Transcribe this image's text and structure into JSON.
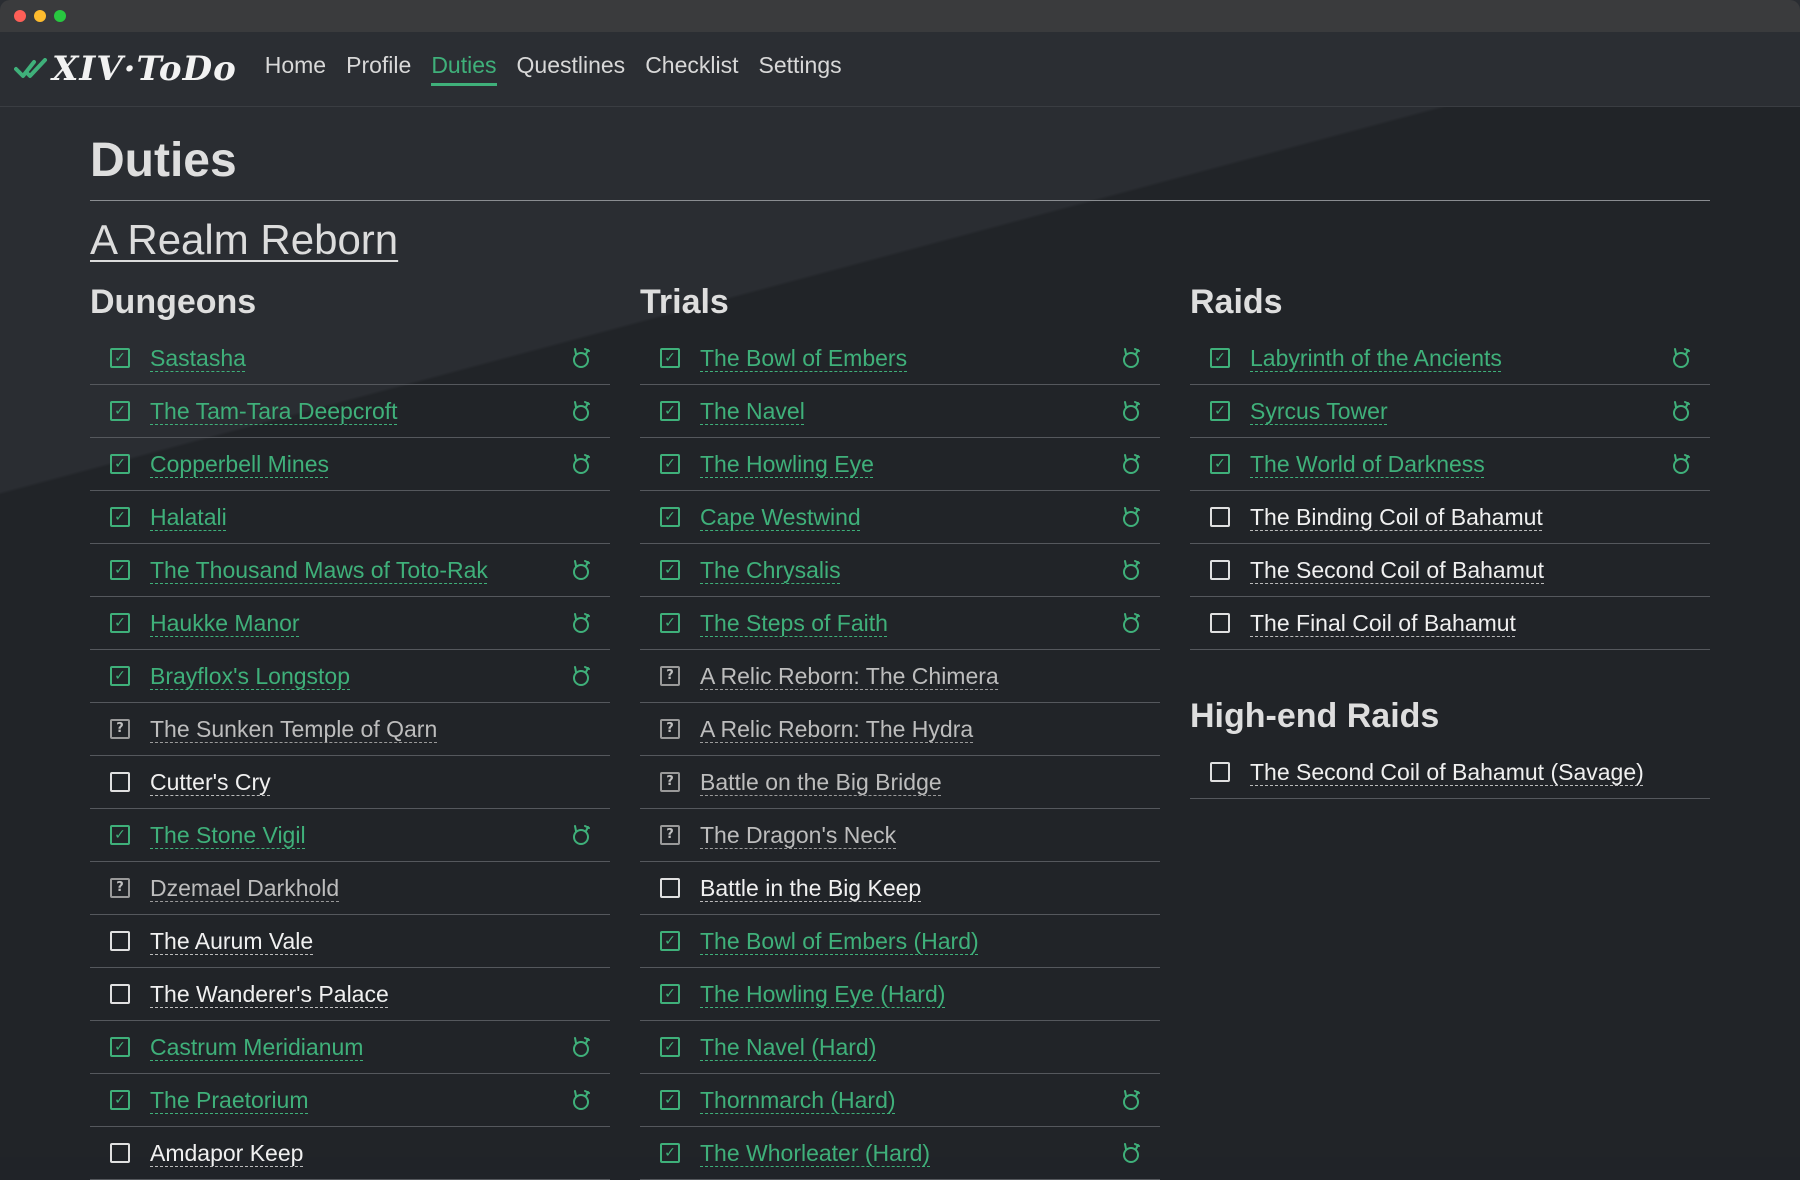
{
  "app": {
    "brand": "XIV·ToDo",
    "nav": [
      {
        "label": "Home",
        "active": false
      },
      {
        "label": "Profile",
        "active": false
      },
      {
        "label": "Duties",
        "active": true
      },
      {
        "label": "Questlines",
        "active": false
      },
      {
        "label": "Checklist",
        "active": false
      },
      {
        "label": "Settings",
        "active": false
      }
    ],
    "accent_color": "#3fb07a"
  },
  "page": {
    "title": "Duties",
    "expansion": "A Realm Reborn"
  },
  "dungeons": {
    "title": "Dungeons",
    "items": [
      {
        "name": "Sastasha",
        "status": "done",
        "icon": "moogle-icon"
      },
      {
        "name": "The Tam-Tara Deepcroft",
        "status": "done",
        "icon": "moogle-icon"
      },
      {
        "name": "Copperbell Mines",
        "status": "done",
        "icon": "moogle-icon"
      },
      {
        "name": "Halatali",
        "status": "done",
        "icon": ""
      },
      {
        "name": "The Thousand Maws of Toto-Rak",
        "status": "done",
        "icon": "moogle-icon"
      },
      {
        "name": "Haukke Manor",
        "status": "done",
        "icon": "moogle-icon"
      },
      {
        "name": "Brayflox's Longstop",
        "status": "done",
        "icon": "moogle-icon"
      },
      {
        "name": "The Sunken Temple of Qarn",
        "status": "unknown",
        "icon": ""
      },
      {
        "name": "Cutter's Cry",
        "status": "todo",
        "icon": ""
      },
      {
        "name": "The Stone Vigil",
        "status": "done",
        "icon": "moogle-icon"
      },
      {
        "name": "Dzemael Darkhold",
        "status": "unknown",
        "icon": ""
      },
      {
        "name": "The Aurum Vale",
        "status": "todo",
        "icon": ""
      },
      {
        "name": "The Wanderer's Palace",
        "status": "todo",
        "icon": ""
      },
      {
        "name": "Castrum Meridianum",
        "status": "done",
        "icon": "moogle-icon"
      },
      {
        "name": "The Praetorium",
        "status": "done",
        "icon": "moogle-icon"
      },
      {
        "name": "Amdapor Keep",
        "status": "todo",
        "icon": ""
      }
    ]
  },
  "trials": {
    "title": "Trials",
    "items": [
      {
        "name": "The Bowl of Embers",
        "status": "done",
        "icon": "moogle-icon"
      },
      {
        "name": "The Navel",
        "status": "done",
        "icon": "moogle-icon"
      },
      {
        "name": "The Howling Eye",
        "status": "done",
        "icon": "moogle-icon"
      },
      {
        "name": "Cape Westwind",
        "status": "done",
        "icon": "moogle-icon"
      },
      {
        "name": "The Chrysalis",
        "status": "done",
        "icon": "moogle-icon"
      },
      {
        "name": "The Steps of Faith",
        "status": "done",
        "icon": "moogle-icon"
      },
      {
        "name": "A Relic Reborn: The Chimera",
        "status": "unknown",
        "icon": ""
      },
      {
        "name": "A Relic Reborn: The Hydra",
        "status": "unknown",
        "icon": ""
      },
      {
        "name": "Battle on the Big Bridge",
        "status": "unknown",
        "icon": ""
      },
      {
        "name": "The Dragon's Neck",
        "status": "unknown",
        "icon": ""
      },
      {
        "name": "Battle in the Big Keep",
        "status": "todo",
        "icon": ""
      },
      {
        "name": "The Bowl of Embers (Hard)",
        "status": "done",
        "icon": ""
      },
      {
        "name": "The Howling Eye (Hard)",
        "status": "done",
        "icon": ""
      },
      {
        "name": "The Navel (Hard)",
        "status": "done",
        "icon": ""
      },
      {
        "name": "Thornmarch (Hard)",
        "status": "done",
        "icon": "moogle-icon"
      },
      {
        "name": "The Whorleater (Hard)",
        "status": "done",
        "icon": "moogle-icon"
      }
    ]
  },
  "raids": {
    "title": "Raids",
    "items": [
      {
        "name": "Labyrinth of the Ancients",
        "status": "done",
        "icon": "moogle-icon"
      },
      {
        "name": "Syrcus Tower",
        "status": "done",
        "icon": "moogle-icon"
      },
      {
        "name": "The World of Darkness",
        "status": "done",
        "icon": "moogle-icon"
      },
      {
        "name": "The Binding Coil of Bahamut",
        "status": "todo",
        "icon": ""
      },
      {
        "name": "The Second Coil of Bahamut",
        "status": "todo",
        "icon": ""
      },
      {
        "name": "The Final Coil of Bahamut",
        "status": "todo",
        "icon": ""
      }
    ]
  },
  "high_end_raids": {
    "title": "High-end Raids",
    "items": [
      {
        "name": "The Second Coil of Bahamut (Savage)",
        "status": "todo",
        "icon": ""
      }
    ]
  }
}
